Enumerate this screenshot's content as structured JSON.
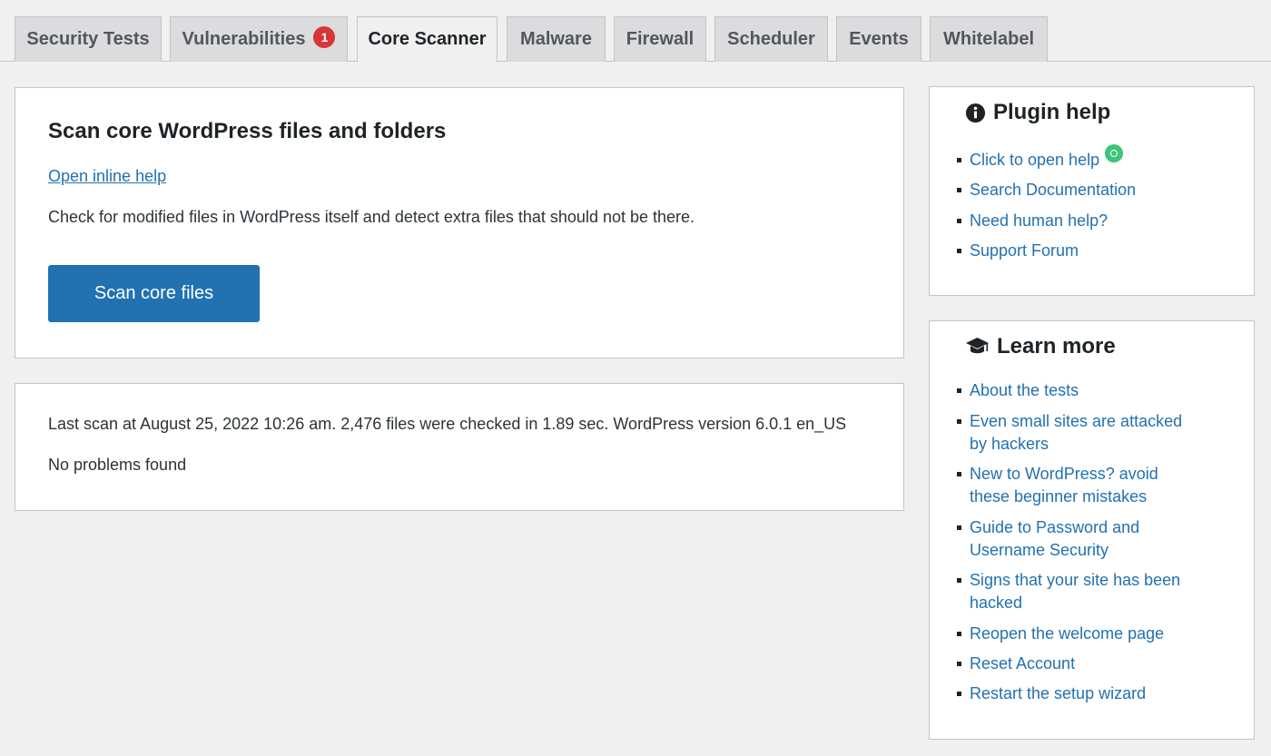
{
  "tabs": [
    {
      "label": "Security Tests"
    },
    {
      "label": "Vulnerabilities",
      "badge": "1"
    },
    {
      "label": "Core Scanner",
      "active": true
    },
    {
      "label": "Malware"
    },
    {
      "label": "Firewall"
    },
    {
      "label": "Scheduler"
    },
    {
      "label": "Events"
    },
    {
      "label": "Whitelabel"
    }
  ],
  "scan_panel": {
    "title": "Scan core WordPress files and folders",
    "inline_help": "Open inline help",
    "description": "Check for modified files in WordPress itself and detect extra files that should not be there.",
    "button_label": "Scan core files"
  },
  "results_panel": {
    "last_scan": "Last scan at August 25, 2022 10:26 am. 2,476 files were checked in 1.89 sec. WordPress version 6.0.1 en_US",
    "status": "No problems found"
  },
  "plugin_help": {
    "title": "Plugin help",
    "icon": "info-icon",
    "links": [
      "Click to open help",
      "Search Documentation",
      "Need human help?",
      "Support Forum"
    ]
  },
  "learn_more": {
    "title": "Learn more",
    "icon": "graduation-cap-icon",
    "links": [
      {
        "line1": "About the tests"
      },
      {
        "line1": "Even small sites are attacked",
        "line2": "by hackers"
      },
      {
        "line1": "New to WordPress? avoid",
        "line2": "these beginner mistakes"
      },
      {
        "line1": "Guide to Password and",
        "line2": "Username Security"
      },
      {
        "line1": "Signs that your site has been",
        "line2": "hacked"
      },
      {
        "line1": "Reopen the welcome page"
      },
      {
        "line1": "Reset Account"
      },
      {
        "line1": "Restart the setup wizard"
      }
    ]
  },
  "colors": {
    "background": "#f0f0f1",
    "link": "#2271b1",
    "primary_button": "#2271b1",
    "badge": "#d63638",
    "chat_indicator": "#3ec47a"
  }
}
